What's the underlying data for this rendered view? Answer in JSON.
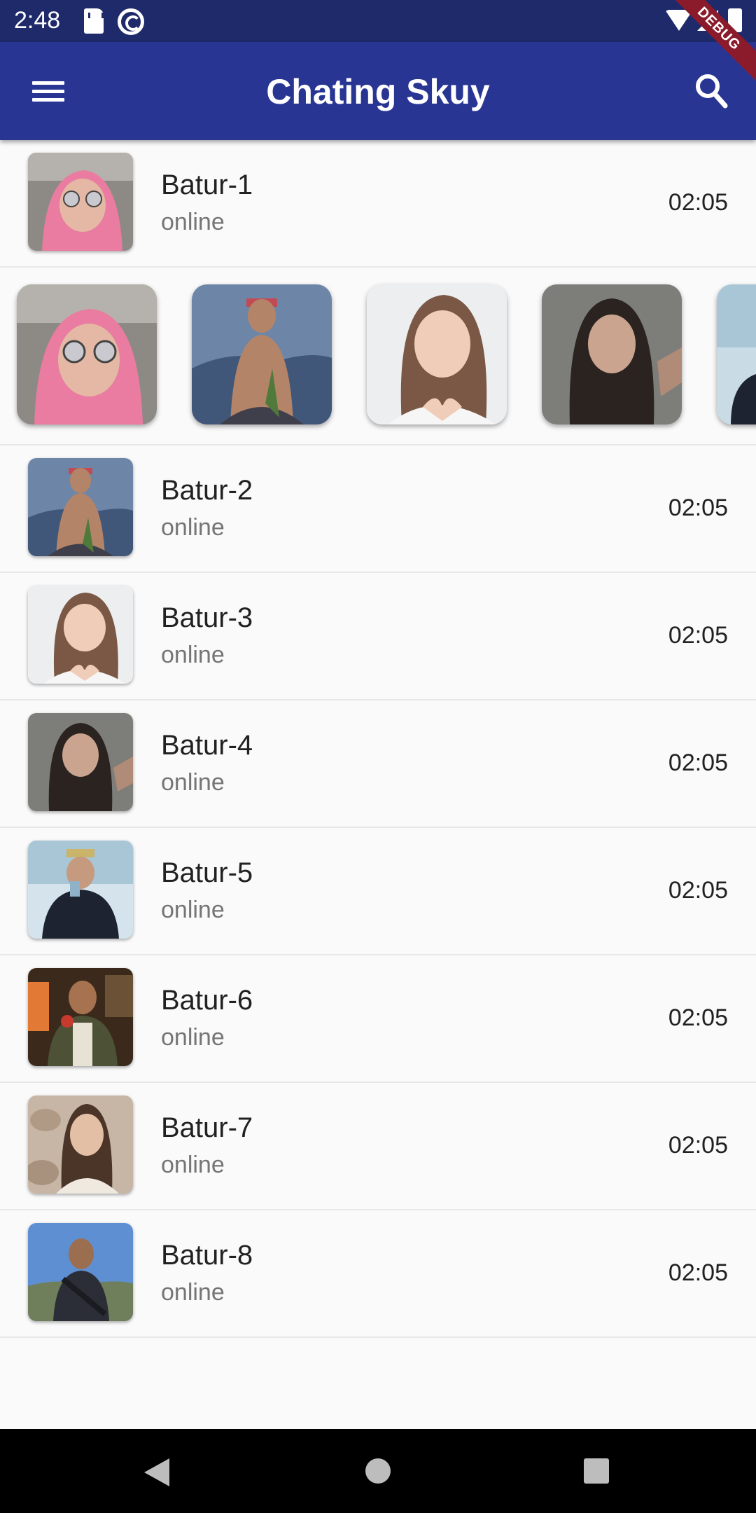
{
  "status_bar": {
    "time": "2:48"
  },
  "debug_banner": "DEBUG",
  "app_bar": {
    "title": "Chating Skuy"
  },
  "chats": [
    {
      "name": "Batur-1",
      "status": "online",
      "time": "02:05"
    },
    {
      "name": "Batur-2",
      "status": "online",
      "time": "02:05"
    },
    {
      "name": "Batur-3",
      "status": "online",
      "time": "02:05"
    },
    {
      "name": "Batur-4",
      "status": "online",
      "time": "02:05"
    },
    {
      "name": "Batur-5",
      "status": "online",
      "time": "02:05"
    },
    {
      "name": "Batur-6",
      "status": "online",
      "time": "02:05"
    },
    {
      "name": "Batur-7",
      "status": "online",
      "time": "02:05"
    },
    {
      "name": "Batur-8",
      "status": "online",
      "time": "02:05"
    }
  ],
  "colors": {
    "app_bar": "#283593",
    "status_bar": "#1f2a6b",
    "debug": "#8b1a2a"
  }
}
